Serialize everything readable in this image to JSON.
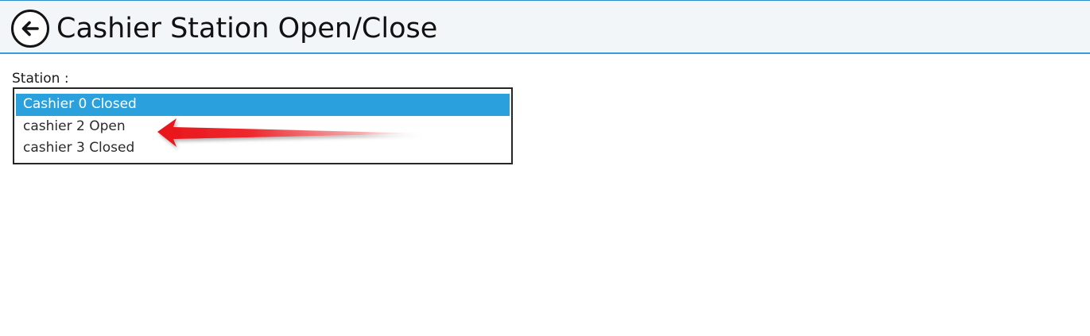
{
  "header": {
    "title": "Cashier Station Open/Close",
    "back_icon": "arrow-left-circle-icon"
  },
  "station": {
    "label": "Station :",
    "options": [
      {
        "label": "Cashier 0 Closed",
        "selected": true
      },
      {
        "label": "cashier 2 Open",
        "selected": false
      },
      {
        "label": "cashier 3 Closed",
        "selected": false
      }
    ]
  },
  "colors": {
    "header_background": "#f2f6f9",
    "header_border": "#3a9ad9",
    "selection": "#2aa1dc",
    "annotation_arrow": "#e8141a"
  }
}
